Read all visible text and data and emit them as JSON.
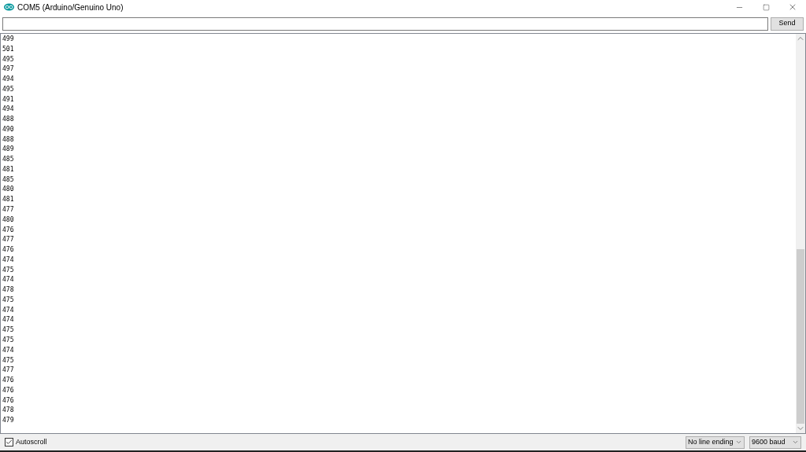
{
  "window": {
    "title": "COM5 (Arduino/Genuino Uno)"
  },
  "input": {
    "send_label": "Send"
  },
  "output_lines": [
    "499",
    "501",
    "495",
    "497",
    "494",
    "495",
    "491",
    "494",
    "488",
    "490",
    "488",
    "489",
    "485",
    "481",
    "485",
    "480",
    "481",
    "477",
    "480",
    "476",
    "477",
    "476",
    "474",
    "475",
    "474",
    "478",
    "475",
    "474",
    "474",
    "475",
    "475",
    "474",
    "475",
    "477",
    "476",
    "476",
    "476",
    "478",
    "479"
  ],
  "status_bar": {
    "autoscroll": {
      "label": "Autoscroll",
      "checked": true
    },
    "line_ending": "No line ending",
    "baud": "9600 baud"
  }
}
